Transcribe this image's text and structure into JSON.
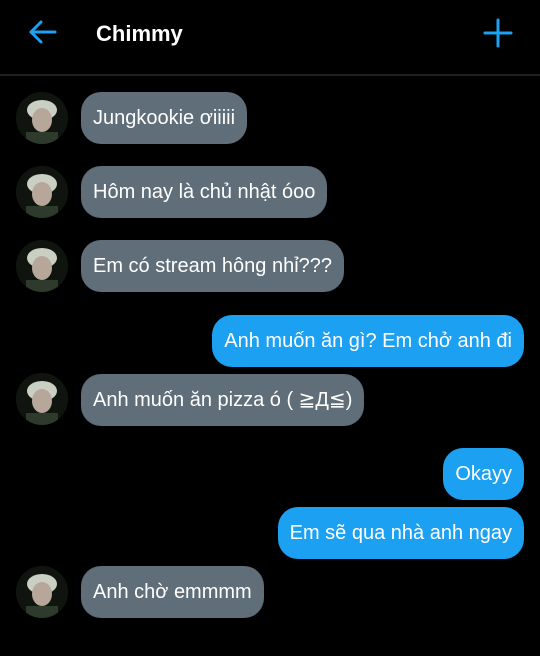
{
  "header": {
    "title": "Chimmy",
    "back_icon": "arrow-left-icon",
    "add_icon": "plus-icon",
    "accent_color": "#1da1f2"
  },
  "colors": {
    "incoming_bubble": "#5f6e78",
    "outgoing_bubble": "#1ba0f2",
    "background": "#000000"
  },
  "messages": [
    {
      "direction": "in",
      "text": "Jungkookie ơiiiii"
    },
    {
      "direction": "in",
      "text": "Hôm nay là chủ nhật óoo"
    },
    {
      "direction": "in",
      "text": "Em có stream hông nhỉ???"
    },
    {
      "direction": "out",
      "text": "Anh muốn ăn gì? Em chở anh đi"
    },
    {
      "direction": "in",
      "text": "Anh muốn ăn pizza ó ( ≧Д≦)"
    },
    {
      "direction": "out",
      "text": "Okayy"
    },
    {
      "direction": "out",
      "text": "Em sẽ qua nhà anh ngay"
    },
    {
      "direction": "in",
      "text": "Anh chờ emmmm"
    }
  ]
}
